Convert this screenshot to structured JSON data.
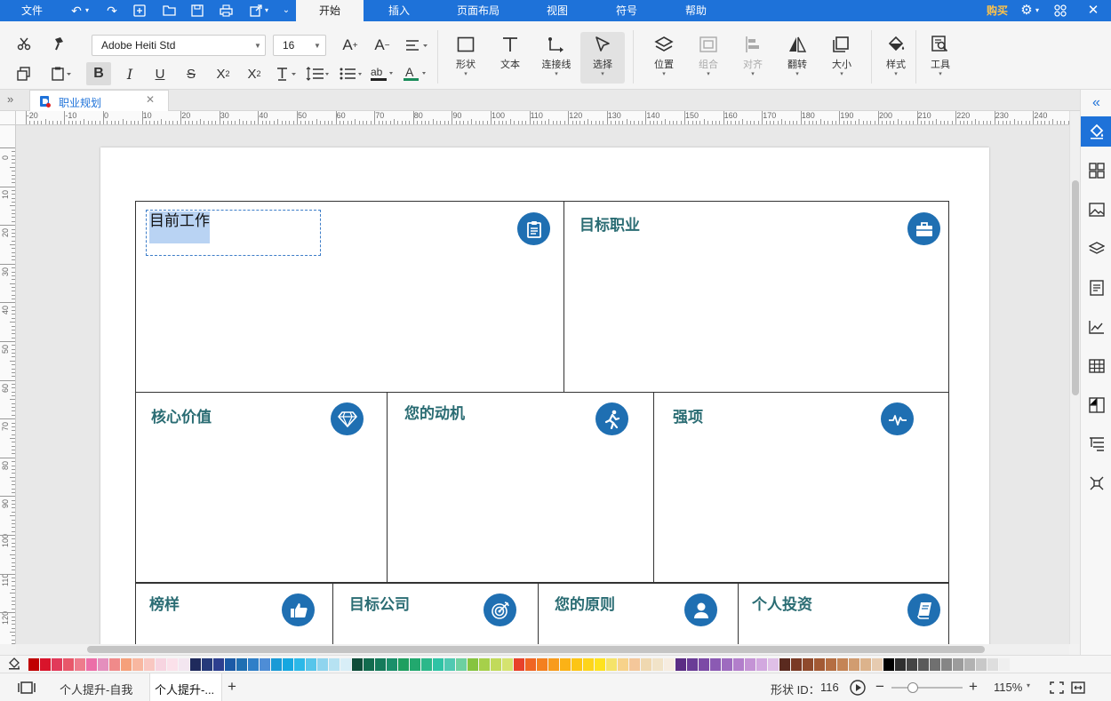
{
  "menubar": {
    "items": [
      "文件",
      "开始",
      "插入",
      "页面布局",
      "视图",
      "符号",
      "帮助"
    ],
    "buy": "购买"
  },
  "toolbar": {
    "font_family": "Adobe Heiti Std",
    "font_size": "16",
    "shape_label": "形状",
    "text_label": "文本",
    "connector_label": "连接线",
    "select_label": "选择",
    "position_label": "位置",
    "group_label": "组合",
    "align_label": "对齐",
    "flip_label": "翻转",
    "size_label": "大小",
    "style_label": "样式",
    "tools_label": "工具"
  },
  "tab": {
    "title": "职业规划"
  },
  "ruler": {
    "h_ticks": [
      "-20",
      "-10",
      "0",
      "10",
      "20",
      "30",
      "40",
      "50",
      "60",
      "70",
      "80",
      "90",
      "100",
      "110",
      "120",
      "130",
      "140",
      "150",
      "160",
      "170",
      "180",
      "190",
      "200",
      "210",
      "220",
      "230",
      "240"
    ],
    "v_ticks": [
      "0",
      "10",
      "20",
      "30",
      "40",
      "50",
      "60",
      "70",
      "80",
      "90",
      "100",
      "110",
      "120"
    ]
  },
  "canvas": {
    "cells": [
      {
        "title": "目前工作",
        "icon": "clipboard-icon"
      },
      {
        "title": "目标职业",
        "icon": "briefcase-icon"
      },
      {
        "title": "核心价值",
        "icon": "diamond-icon"
      },
      {
        "title": "您的动机",
        "icon": "runner-icon"
      },
      {
        "title": "强项",
        "icon": "heartbeat-icon"
      },
      {
        "title": "榜样",
        "icon": "thumbs-up-icon"
      },
      {
        "title": "目标公司",
        "icon": "target-icon"
      },
      {
        "title": "您的原则",
        "icon": "person-icon"
      },
      {
        "title": "个人投资",
        "icon": "book-icon"
      }
    ],
    "accent": "#1f6fb2",
    "title_color": "#2a6c73"
  },
  "status": {
    "page_tab1": "个人提升-自我",
    "page_tab2": "个人提升-...",
    "shape_id_label": "形状 ID：",
    "shape_id": "116",
    "zoom": "115%"
  },
  "palette": [
    "#c00000",
    "#d9142b",
    "#e13a5a",
    "#e8576a",
    "#ee7b8c",
    "#ec6ea8",
    "#e48fbd",
    "#f08a8a",
    "#f5a07a",
    "#f8b7a0",
    "#f9c7c1",
    "#f7d4e0",
    "#fbe1ea",
    "#f3e6f0",
    "#1f2a5c",
    "#253a7a",
    "#2d3f8f",
    "#1b5aa6",
    "#1f6fb2",
    "#2f7fc8",
    "#4e8dd6",
    "#1a9ad6",
    "#16a7e0",
    "#2bb8e8",
    "#57c5ea",
    "#8fd4ee",
    "#b6e2f2",
    "#d8eef7",
    "#0f4d3a",
    "#126b4e",
    "#147a5a",
    "#1a8f6a",
    "#1e9f60",
    "#22a86e",
    "#2cb88a",
    "#2fc3a5",
    "#50c9b2",
    "#6dd0a0",
    "#86c440",
    "#a6d04a",
    "#c1da5a",
    "#d5e36f",
    "#e8412a",
    "#f06522",
    "#f4801f",
    "#f89b1c",
    "#fbb216",
    "#fcc515",
    "#fdd41b",
    "#fee21f",
    "#f5e36a",
    "#f7d28a",
    "#f4c79a",
    "#efd8b0",
    "#f1e3c8",
    "#f6ece0",
    "#5b2d84",
    "#6a3c96",
    "#7c4aa6",
    "#8b5ab3",
    "#9e6bbf",
    "#b27ecb",
    "#c493d5",
    "#d2a8df",
    "#dfbfe7",
    "#5a2a1f",
    "#7a3a25",
    "#8f4a2c",
    "#a35a34",
    "#b56e42",
    "#c48456",
    "#d19c70",
    "#dcb38c",
    "#e6cbb0",
    "#000000",
    "#2f2f2f",
    "#454545",
    "#5a5a5a",
    "#707070",
    "#868686",
    "#9c9c9c",
    "#b2b2b2",
    "#c8c8c8",
    "#dedede",
    "#efefef"
  ]
}
